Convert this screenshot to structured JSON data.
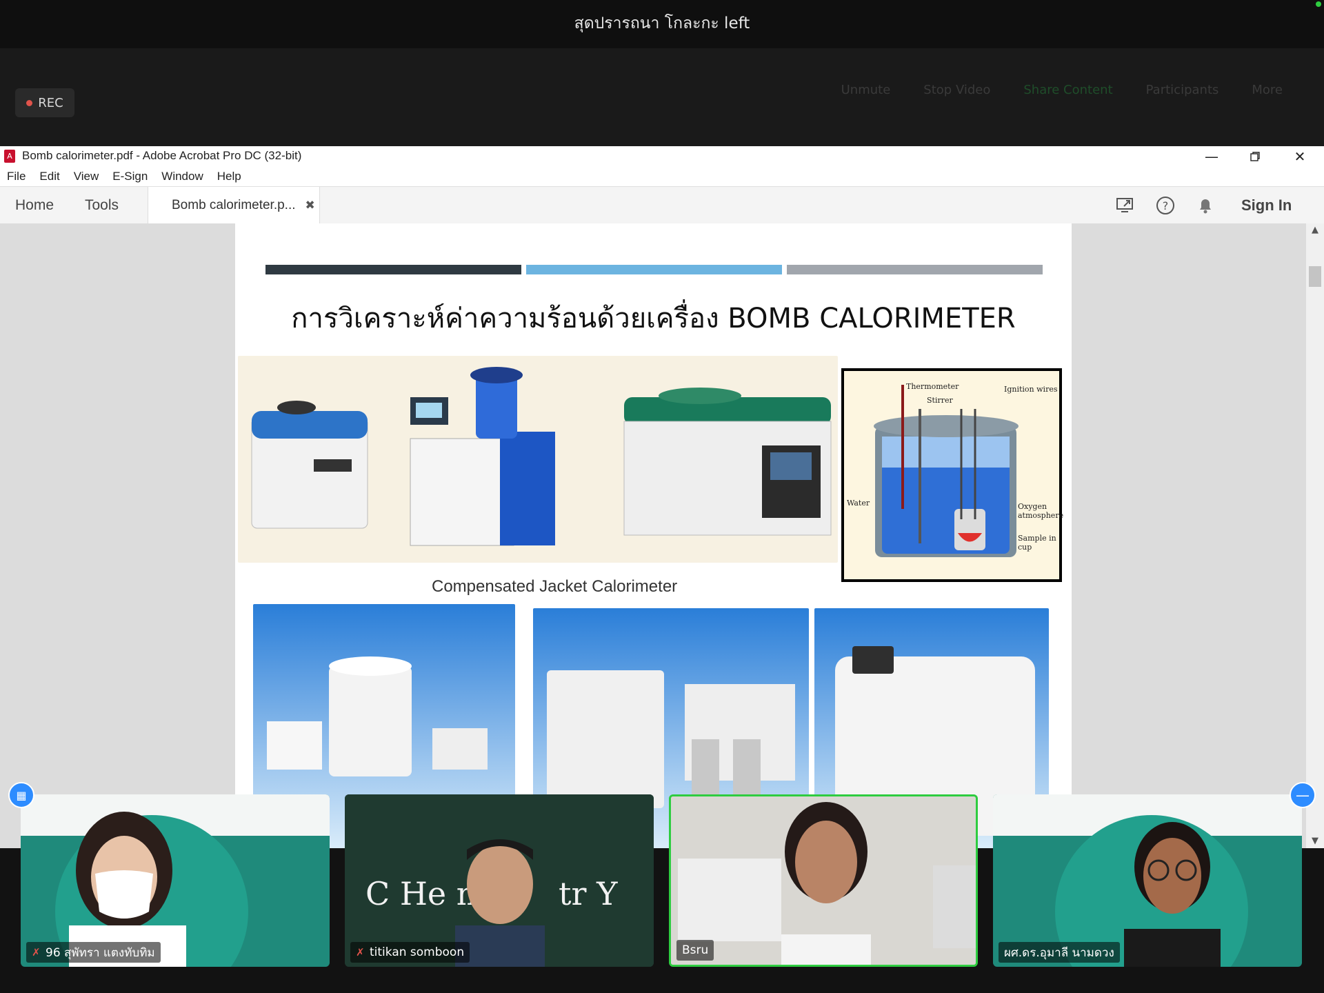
{
  "zoom": {
    "share_notice": "สุดปรารถนา โกละกะ left",
    "rec_label": "REC",
    "ghost_labels": [
      "Unmute",
      "Stop Video",
      "Share Content",
      "Participants",
      "More"
    ]
  },
  "acrobat": {
    "title": "Bomb calorimeter.pdf - Adobe Acrobat Pro DC (32-bit)",
    "menu": [
      "File",
      "Edit",
      "View",
      "E-Sign",
      "Window",
      "Help"
    ],
    "tabs": {
      "home": "Home",
      "tools": "Tools",
      "doc": "Bomb calorimeter.p..."
    },
    "sign_in": "Sign In",
    "icons": {
      "share": "screen-share-icon",
      "help": "help-icon",
      "notify": "bell-icon",
      "close": "close-icon"
    }
  },
  "slide": {
    "title": "การวิเคราะห์ค่าความร้อนด้วยเครื่อง BOMB CALORIMETER",
    "caption": "Compensated Jacket Calorimeter",
    "bar_colors": [
      "#2f3a42",
      "#6cb4e0",
      "#a1a6ad"
    ],
    "diagram_labels": {
      "thermometer": "Thermometer",
      "stirrer": "Stirrer",
      "ignition": "Ignition wires",
      "water": "Water",
      "oxygen": "Oxygen atmosphere",
      "sample": "Sample in cup"
    }
  },
  "participants": [
    {
      "name": "96 สุพัทรา แตงทับทิม",
      "muted": true
    },
    {
      "name": "titikan somboon",
      "muted": true
    },
    {
      "name": "Bsru",
      "muted": false
    },
    {
      "name": "ผศ.ดร.อุมาลี นามดวง",
      "muted": false
    }
  ]
}
